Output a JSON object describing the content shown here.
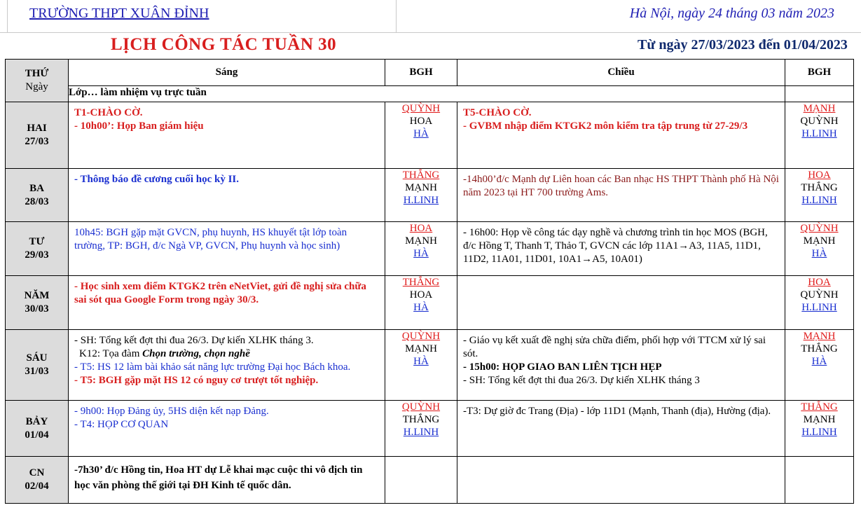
{
  "header": {
    "school": "TRƯỜNG  THPT XUÂN ĐỈNH",
    "date": "Hà Nội, ngày 24  tháng  03  năm 2023"
  },
  "title": "LỊCH CÔNG TÁC TUẦN 30",
  "range": "Từ ngày 27/03/2023 đến 01/04/2023",
  "columns": {
    "thu": "THỨ",
    "ngay": "Ngày",
    "sang": "Sáng",
    "bgh1": "BGH",
    "chieu": "Chiều",
    "bgh2": "BGH"
  },
  "duty": "Lớp… làm nhiệm vụ trực tuần",
  "days": [
    {
      "name": "HAI",
      "date": "27/03",
      "sang": [
        "T1-CHÀO CỜ.",
        "- 10h00’: Họp Ban giám hiệu"
      ],
      "bgh_sang": [
        "QUỲNH",
        "HOA",
        "HÀ"
      ],
      "chieu": [
        "T5-CHÀO CỜ.",
        "- GVBM nhập điểm KTGK2  môn kiểm tra tập trung từ 27-29/3"
      ],
      "bgh_chieu": [
        "MẠNH",
        "QUỲNH",
        "H.LINH"
      ]
    },
    {
      "name": "BA",
      "date": "28/03",
      "sang": [
        "- Thông báo đề cương cuối học kỳ II."
      ],
      "bgh_sang": [
        "THẮNG",
        "MẠNH",
        "H.LINH"
      ],
      "chieu": [
        "-14h00’đ/c Mạnh dự Liên hoan các Ban nhạc HS THPT Thành phố Hà Nội năm 2023 tại HT 700 trường Ams."
      ],
      "bgh_chieu": [
        "HOA",
        "THẮNG",
        "H.LINH"
      ]
    },
    {
      "name": "TƯ",
      "date": "29/03",
      "sang": [
        "10h45: BGH gặp mặt GVCN, phụ huynh, HS khuyết tật lớp toàn trường, TP: BGH, đ/c Ngà VP, GVCN, Phụ huynh và học sinh)"
      ],
      "bgh_sang": [
        "HOA",
        "MẠNH",
        "HÀ"
      ],
      "chieu": [
        "- 16h00: Họp  về công tác dạy nghề và chương trình tin học MOS (BGH, đ/c Hồng T, Thanh T, Thảo T, GVCN các lớp 11A1→A3, 11A5, 11D1, 11D2, 11A01, 11D01, 10A1→A5, 10A01)"
      ],
      "bgh_chieu": [
        "QUỲNH",
        "MẠNH",
        "HÀ"
      ]
    },
    {
      "name": "NĂM",
      "date": "30/03",
      "sang": [
        "- Học sinh xem điểm KTGK2 trên eNetViet, gửi đề nghị sửa chữa sai sót qua Google Form trong ngày 30/3."
      ],
      "bgh_sang": [
        "THẮNG",
        "HOA",
        "HÀ"
      ],
      "chieu": [],
      "bgh_chieu": [
        "HOA",
        "QUỲNH",
        "H.LINH"
      ]
    },
    {
      "name": "SÁU",
      "date": "31/03",
      "sang": [
        "- SH: Tổng kết đợt thi đua 26/3. Dự kiến XLHK tháng 3.",
        "K12: Tọa đàm ",
        "Chọn trường, chọn nghề",
        "- T5: HS 12 làm bài khảo sát năng lực trường Đại học Bách khoa.",
        "- T5: BGH gặp mặt HS 12 có nguy cơ trượt tốt nghiệp."
      ],
      "bgh_sang": [
        "QUỲNH",
        "MẠNH",
        "HÀ"
      ],
      "chieu": [
        "- Giáo vụ kết xuất đề nghị sửa chữa điểm, phối hợp với TTCM xử lý sai sót.",
        "- 15h00: HỌP GIAO BAN LIÊN TỊCH HẸP",
        "- SH: Tổng kết đợt thi đua 26/3. Dự kiến XLHK tháng 3"
      ],
      "bgh_chieu": [
        "MẠNH",
        "THẮNG",
        "HÀ"
      ]
    },
    {
      "name": "BẢY",
      "date": "01/04",
      "sang": [
        "- 9h00: Họp Đảng ủy, 5HS diện kết nạp Đảng.",
        "- T4: HỌP CƠ QUAN"
      ],
      "bgh_sang": [
        "QUỲNH",
        "THẮNG",
        "H.LINH"
      ],
      "chieu": [
        "-T3: Dự giờ đc Trang (Địa) - lớp 11D1 (Mạnh, Thanh (địa), Hường (địa)."
      ],
      "bgh_chieu": [
        "THẮNG",
        "MẠNH",
        "H.LINH"
      ]
    },
    {
      "name": "CN",
      "date": "02/04",
      "sang": [
        "-7h30’ đ/c Hồng tin, Hoa HT dự Lễ khai mạc cuộc thi vô địch tin học văn phòng thế giới tại ĐH Kinh tế quốc dân."
      ],
      "bgh_sang": [],
      "chieu": [],
      "bgh_chieu": []
    }
  ]
}
